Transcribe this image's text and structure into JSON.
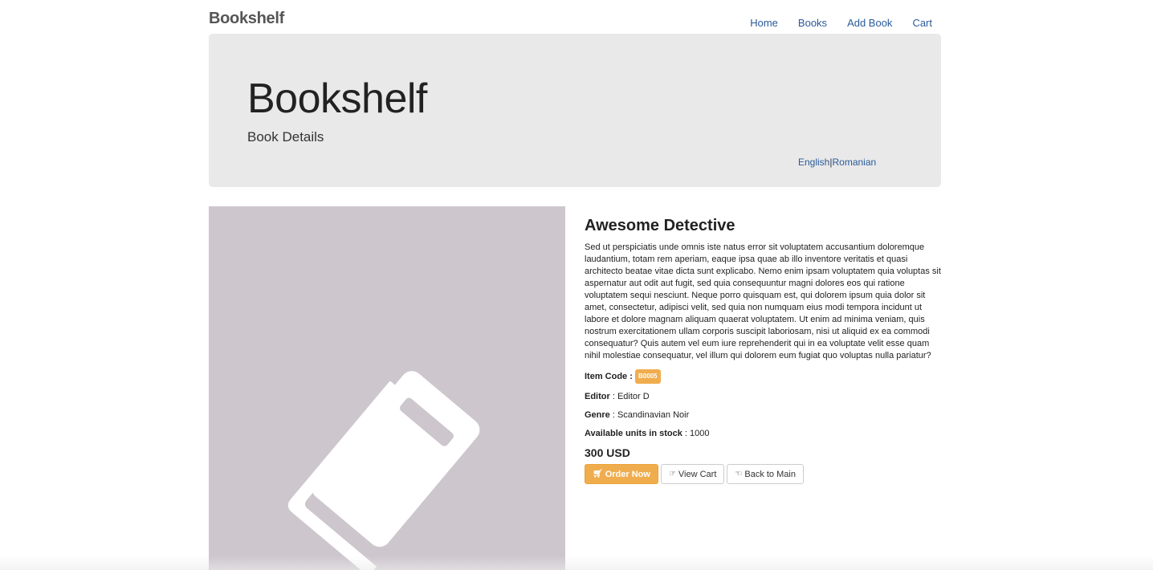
{
  "navbar": {
    "brand": "Bookshelf",
    "links": [
      "Home",
      "Books",
      "Add Book",
      "Cart"
    ]
  },
  "jumbotron": {
    "title": "Bookshelf",
    "subtitle": "Book Details",
    "lang_english": "English",
    "lang_separator": "|",
    "lang_romanian": "Romanian"
  },
  "cover": {
    "icon": "book-icon",
    "background": "#cdc6cd"
  },
  "book": {
    "title": "Awesome Detective",
    "description": "Sed ut perspiciatis unde omnis iste natus error sit voluptatem accusantium doloremque laudantium, totam rem aperiam, eaque ipsa quae ab illo inventore veritatis et quasi architecto beatae vitae dicta sunt explicabo. Nemo enim ipsam voluptatem quia voluptas sit aspernatur aut odit aut fugit, sed quia consequuntur magni dolores eos qui ratione voluptatem sequi nesciunt. Neque porro quisquam est, qui dolorem ipsum quia dolor sit amet, consectetur, adipisci velit, sed quia non numquam eius modi tempora incidunt ut labore et dolore magnam aliquam quaerat voluptatem. Ut enim ad minima veniam, quis nostrum exercitationem ullam corporis suscipit laboriosam, nisi ut aliquid ex ea commodi consequatur? Quis autem vel eum iure reprehenderit qui in ea voluptate velit esse quam nihil molestiae consequatur, vel illum qui dolorem eum fugiat quo voluptas nulla pariatur?",
    "item_code_label": "Item Code :",
    "item_code": "B0005",
    "editor_label": "Editor",
    "editor_sep": " : ",
    "editor": "Editor D",
    "genre_label": "Genre",
    "genre_sep": " : ",
    "genre": "Scandinavian Noir",
    "stock_label": "Available units in stock",
    "stock_sep": " : ",
    "stock": "1000",
    "price": "300 USD"
  },
  "buttons": {
    "order": "Order Now",
    "view_cart": "View Cart",
    "back": "Back to Main"
  },
  "colors": {
    "accent": "#f0ad4e",
    "link": "#2a5a9a",
    "jumbotron": "#e9e9e9"
  }
}
